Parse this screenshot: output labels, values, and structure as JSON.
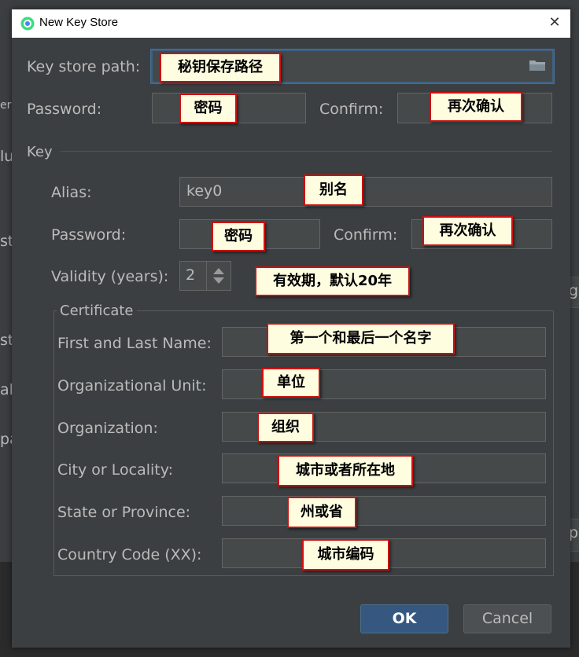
{
  "window": {
    "title": "New Key Store",
    "close_label": "✕"
  },
  "background_fragments": {
    "f1": "er",
    "f2": "lu",
    "f3": "st",
    "f4": "st",
    "f5": "al",
    "f6": "pa",
    "r1": "g",
    "r2": "p"
  },
  "keystore": {
    "path_label": "Key store path:",
    "path_value": "",
    "password_label": "Password:",
    "confirm_label": "Confirm:"
  },
  "key": {
    "section_label": "Key",
    "alias_label": "Alias:",
    "alias_value": "key0",
    "password_label": "Password:",
    "confirm_label": "Confirm:",
    "validity_label": "Validity (years):",
    "validity_value": "2"
  },
  "certificate": {
    "group_label": "Certificate",
    "first_last_label": "First and Last Name:",
    "org_unit_label": "Organizational Unit:",
    "org_label": "Organization:",
    "city_label": "City or Locality:",
    "state_label": "State or Province:",
    "country_label": "Country Code (XX):"
  },
  "buttons": {
    "ok": "OK",
    "cancel": "Cancel"
  },
  "annotations": {
    "path": "秘钥保存路径",
    "password": "密码",
    "confirm": "再次确认",
    "alias": "别名",
    "key_password": "密码",
    "key_confirm": "再次确认",
    "validity": "有效期，默认20年",
    "first_last": "第一个和最后一个名字",
    "org_unit": "单位",
    "org": "组织",
    "city": "城市或者所在地",
    "state": "州或省",
    "country": "城市编码"
  },
  "colors": {
    "dialog_bg": "#3c3f41",
    "field_bg": "#45494a",
    "accent": "#365880",
    "annotation_border": "#cc1111",
    "annotation_bg": "#fffde0"
  }
}
